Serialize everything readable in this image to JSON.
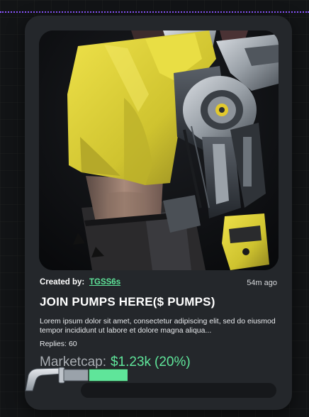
{
  "card": {
    "created_by_label": "Created by:",
    "creator": "TGSS6s",
    "timestamp": "54m ago",
    "title": "JOIN PUMPS HERE($ PUMPS)",
    "description": "Lorem ipsum dolor sit amet, consectetur adipiscing elit, sed do eiusmod tempor incididunt ut labore et dolore magna aliqua...",
    "replies_label": "Replies:",
    "replies_count": "60",
    "marketcap_label": "Marketcap:",
    "marketcap_value": "$1.23k",
    "marketcap_change": "(20%)",
    "progress_fraction": 0.2
  },
  "image": {
    "subject": "cyborg-woman-yellow-jacket"
  },
  "colors": {
    "accent_green": "#5fe59a",
    "card_bg": "#24272b",
    "page_bg": "#121416",
    "border_purple": "#8b54ff",
    "jacket_yellow": "#d8cf3a"
  }
}
